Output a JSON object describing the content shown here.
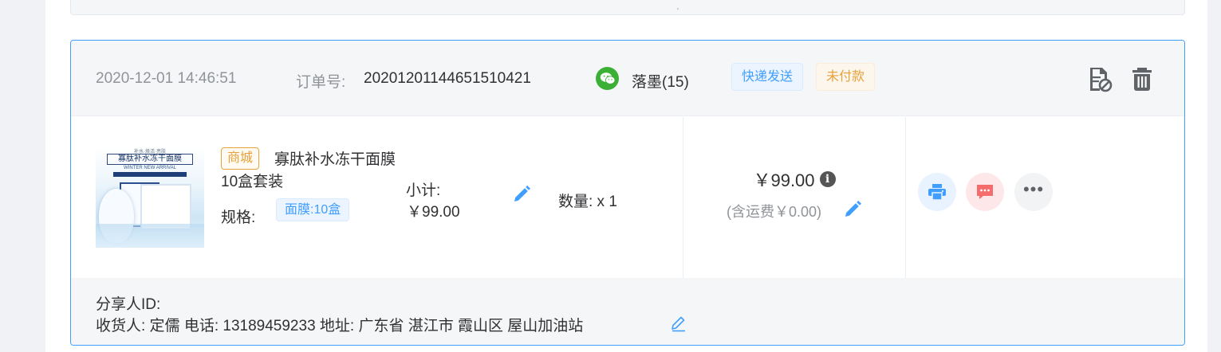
{
  "order": {
    "time": "2020-12-01 14:46:51",
    "order_no_label": "订单号:",
    "order_no": "20201201144651510421",
    "user": "落墨(15)",
    "tags": {
      "express": "快递发送",
      "unpaid": "未付款"
    }
  },
  "item": {
    "mall_tag": "商城",
    "name": "寡肽补水冻干面膜10盒套装",
    "spec_label": "规格:",
    "spec_value": "面膜:10盒",
    "subtotal_label": "小计:",
    "subtotal_value": "￥99.00",
    "quantity": "数量: x 1",
    "image_text": {
      "top": "补水·焕活·亮肤",
      "title": "寡肽补水冻干面膜",
      "en": "WINTER NEW ARRIVAL"
    }
  },
  "totals": {
    "total": "￥99.00",
    "shipping": "(含运费￥0.00)"
  },
  "footer": {
    "share_id": "分享人ID:",
    "receiver_line": "收货人: 定儒 电话: 13189459233 地址: 广东省 湛江市 霞山区 屋山加油站"
  },
  "icons": {
    "wechat": "wechat-icon",
    "hdr_action_1": "document-cancel-icon",
    "hdr_action_2": "trash-icon",
    "print": "printer-icon",
    "message": "message-icon",
    "more": "more-dots-icon",
    "edit": "pencil-icon",
    "info": "info-icon"
  },
  "colors": {
    "primary": "#409eff",
    "warning": "#e6a23c",
    "danger": "#f56c6c",
    "wechat": "#3cb035",
    "border_active": "#409eff"
  }
}
